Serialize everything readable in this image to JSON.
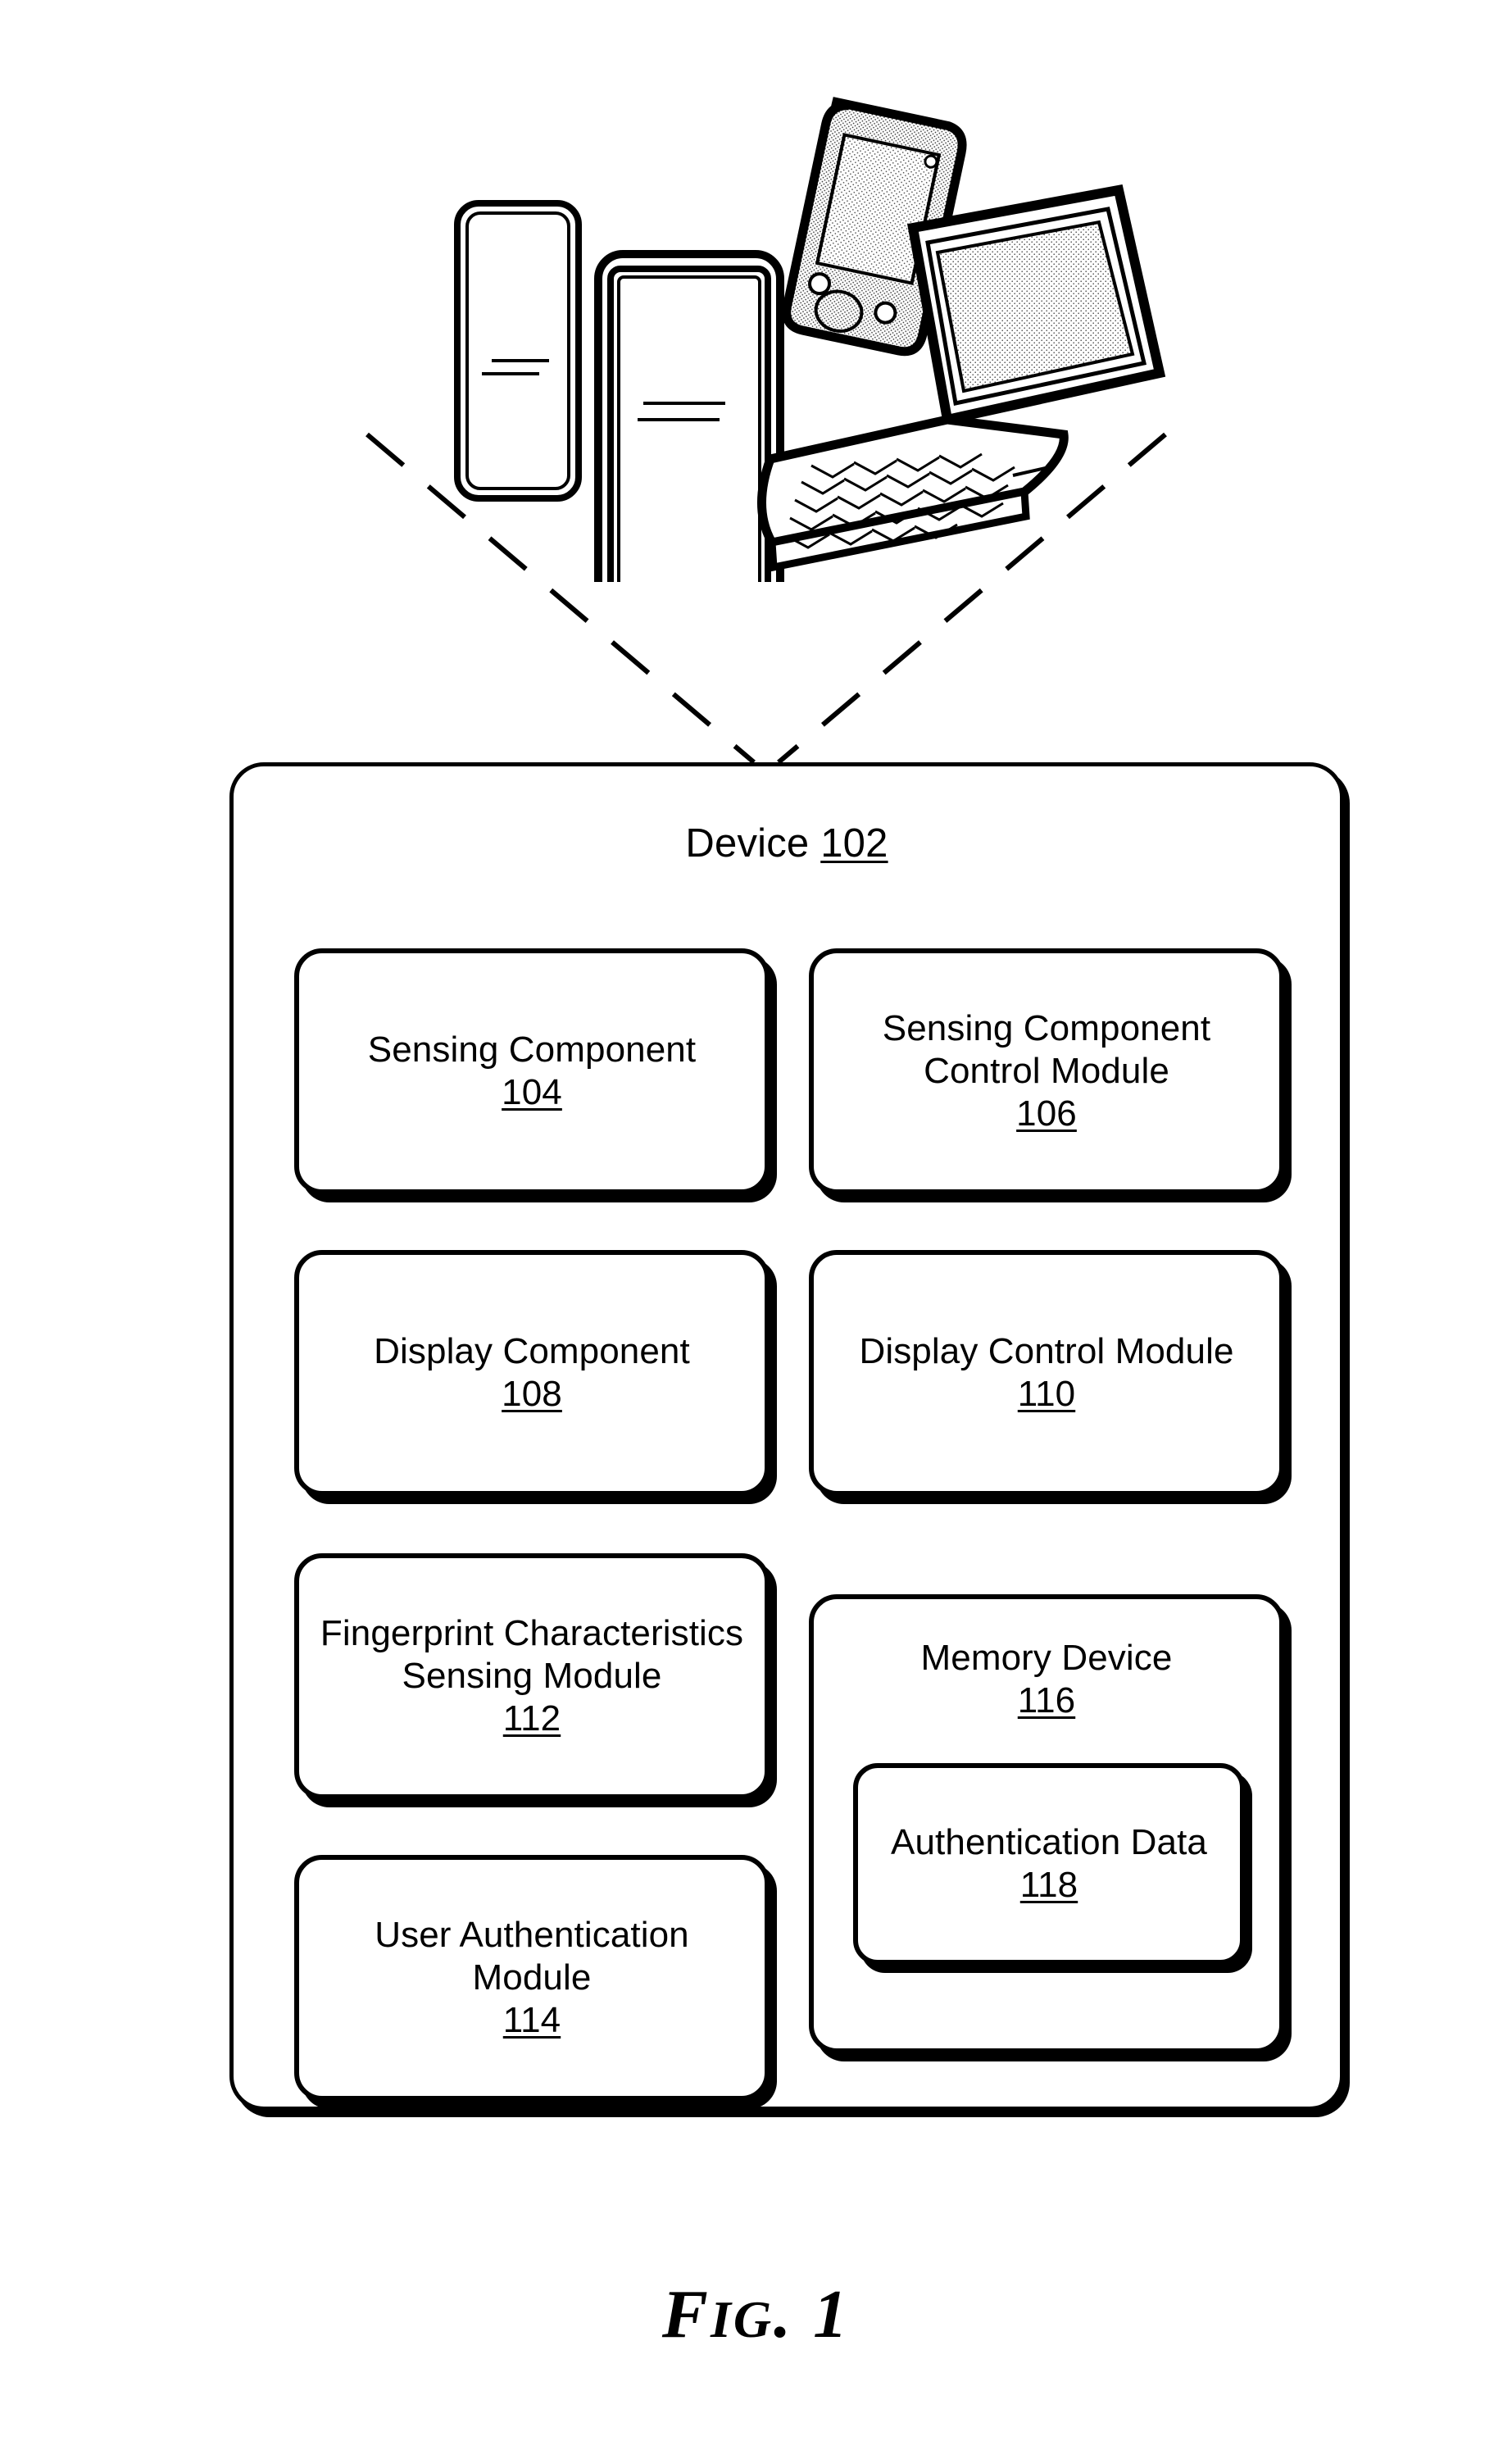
{
  "figure": {
    "caption_prefix": "F",
    "caption_mid": "IG",
    "caption_suffix": ". 1",
    "caption_full": "FIG. 1"
  },
  "device_cluster": {
    "items": [
      {
        "icon": "tablet-device-icon",
        "name": "tablet"
      },
      {
        "icon": "smartphone-device-icon",
        "name": "smartphone"
      },
      {
        "icon": "pda-device-icon",
        "name": "pda"
      },
      {
        "icon": "laptop-device-icon",
        "name": "laptop"
      }
    ]
  },
  "device": {
    "title_text": "Device",
    "title_number": "102",
    "modules": [
      {
        "label": "Sensing Component",
        "number": "104"
      },
      {
        "label": "Sensing Component Control Module",
        "number": "106"
      },
      {
        "label": "Display Component",
        "number": "108"
      },
      {
        "label": "Display Control Module",
        "number": "110"
      },
      {
        "label": "Fingerprint Characteristics Sensing Module",
        "number": "112"
      },
      {
        "label": "User Authentication Module",
        "number": "114"
      },
      {
        "label": "Memory Device",
        "number": "116"
      },
      {
        "label": "Authentication Data",
        "number": "118"
      }
    ]
  },
  "colors": {
    "line": "#000000",
    "background": "#ffffff"
  }
}
